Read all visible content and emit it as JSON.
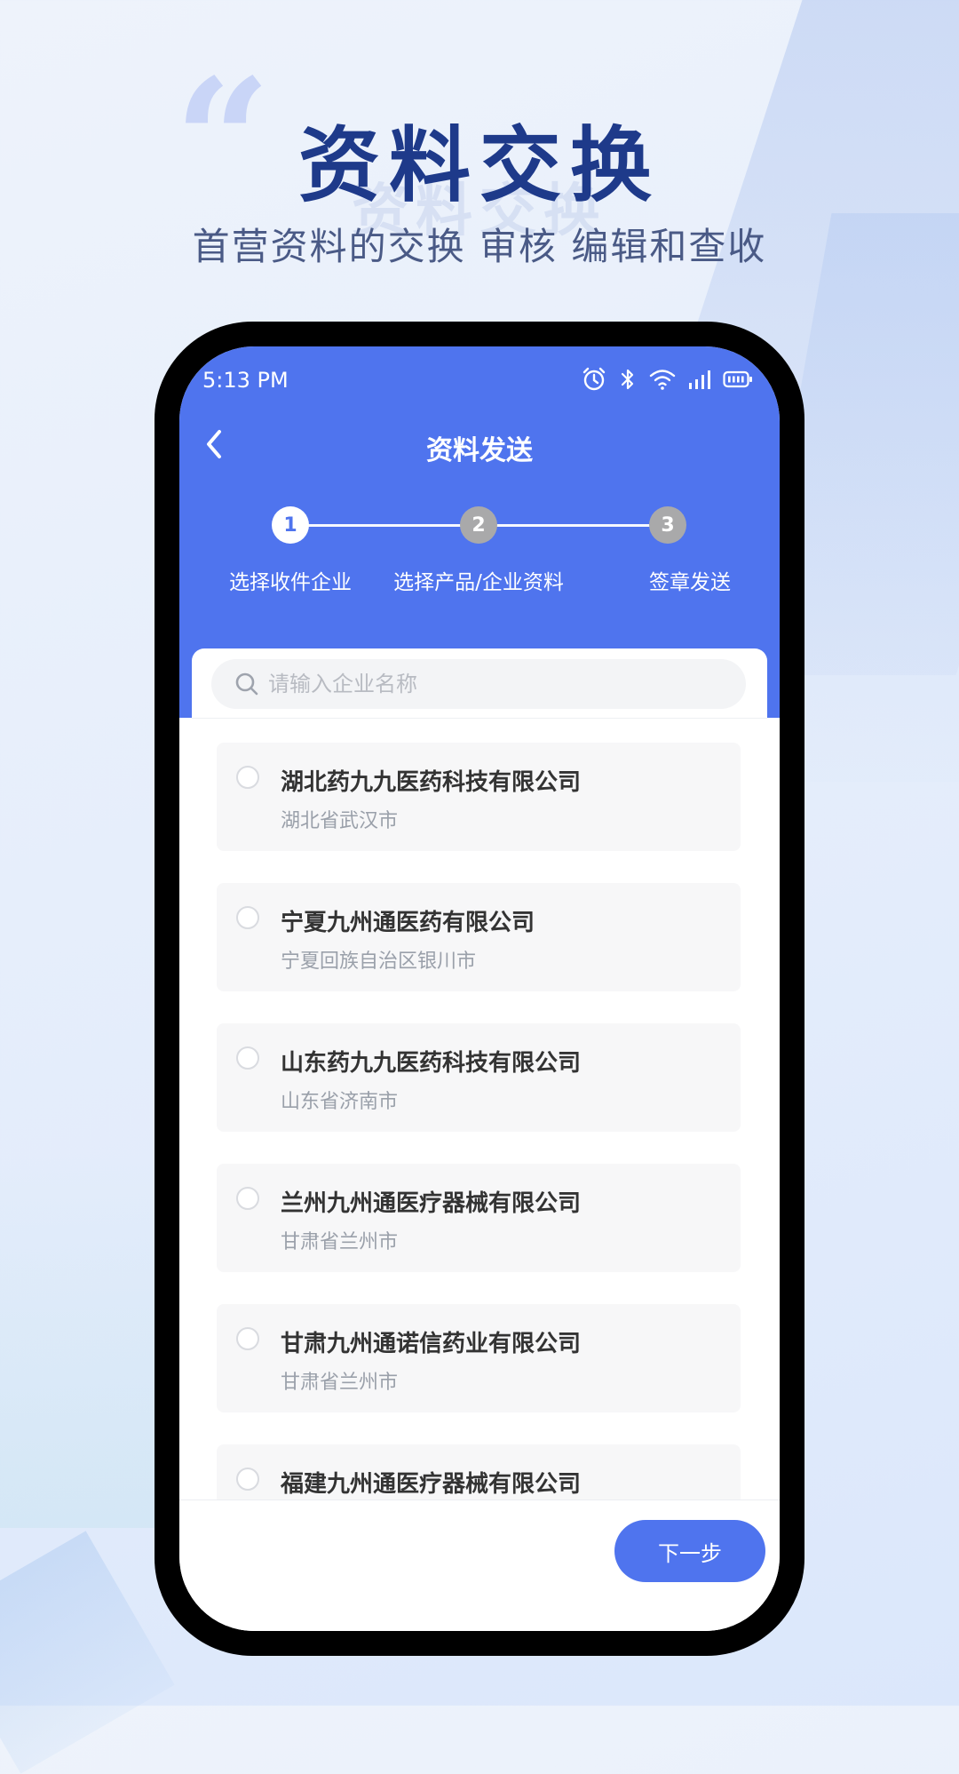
{
  "hero": {
    "quote": "“",
    "title": "资料交换",
    "shadow": "资料交换",
    "subtitle": "首营资料的交换 审核 编辑和查收"
  },
  "status_bar": {
    "time": "5:13 PM",
    "icons": [
      "alarm-icon",
      "bluetooth-icon",
      "wifi-icon",
      "signal-icon",
      "battery-icon"
    ]
  },
  "nav": {
    "back_icon": "chevron-left-icon",
    "title": "资料发送"
  },
  "stepper": {
    "steps": [
      {
        "number": "1",
        "label": "选择收件企业",
        "state": "active"
      },
      {
        "number": "2",
        "label": "选择产品/企业资料",
        "state": "inactive"
      },
      {
        "number": "3",
        "label": "签章发送",
        "state": "inactive"
      }
    ]
  },
  "search": {
    "placeholder": "请输入企业名称",
    "value": ""
  },
  "companies": [
    {
      "name": "湖北药九九医药科技有限公司",
      "region": "湖北省武汉市"
    },
    {
      "name": "宁夏九州通医药有限公司",
      "region": "宁夏回族自治区银川市"
    },
    {
      "name": "山东药九九医药科技有限公司",
      "region": "山东省济南市"
    },
    {
      "name": "兰州九州通医疗器械有限公司",
      "region": "甘肃省兰州市"
    },
    {
      "name": "甘肃九州通诺信药业有限公司",
      "region": "甘肃省兰州市"
    },
    {
      "name": "福建九州通医疗器械有限公司",
      "region": ""
    }
  ],
  "footer": {
    "next_label": "下一步"
  },
  "colors": {
    "primary": "#4f74ee",
    "hero_title": "#1e3a8a"
  }
}
